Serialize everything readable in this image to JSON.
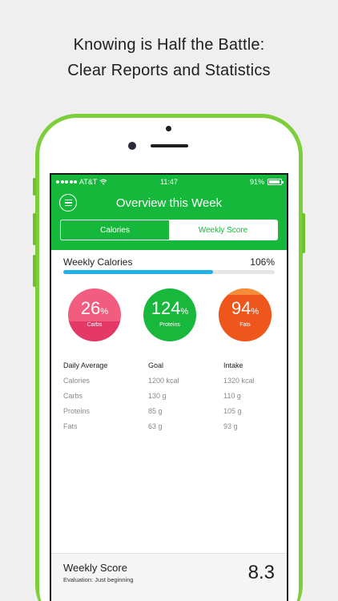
{
  "headline": {
    "line1": "Knowing is Half the Battle:",
    "line2": "Clear Reports and Statistics"
  },
  "status_bar": {
    "carrier": "AT&T",
    "time": "11:47",
    "battery": "91%"
  },
  "header": {
    "title": "Overview this Week",
    "menu_icon": "hamburger-icon"
  },
  "tabs": [
    {
      "label": "Calories",
      "active": true
    },
    {
      "label": "Weekly Score",
      "active": false
    }
  ],
  "weekly_calories": {
    "label": "Weekly Calories",
    "value": "106%",
    "progress_fraction": 0.71,
    "bar_color": "#1fb1e6"
  },
  "macros": [
    {
      "value": "26",
      "unit": "%",
      "label": "Carbs",
      "color": "#f25c7e"
    },
    {
      "value": "124",
      "unit": "%",
      "label": "Proteins",
      "color": "#17b83b"
    },
    {
      "value": "94",
      "unit": "%",
      "label": "Fats",
      "color": "#f05a1c"
    }
  ],
  "table": {
    "headers": [
      "Daily Average",
      "Goal",
      "Intake"
    ],
    "rows": [
      [
        "Calories",
        "1200 kcal",
        "1320 kcal"
      ],
      [
        "Carbs",
        "130 g",
        "110 g"
      ],
      [
        "Proteins",
        "85 g",
        "105 g"
      ],
      [
        "Fats",
        "63 g",
        "93 g"
      ]
    ]
  },
  "footer": {
    "title": "Weekly Score",
    "evaluation": "Evaluation: Just beginning",
    "score": "8.3"
  },
  "colors": {
    "brand_green": "#16b83b",
    "phone_frame": "#7ccf3a"
  }
}
